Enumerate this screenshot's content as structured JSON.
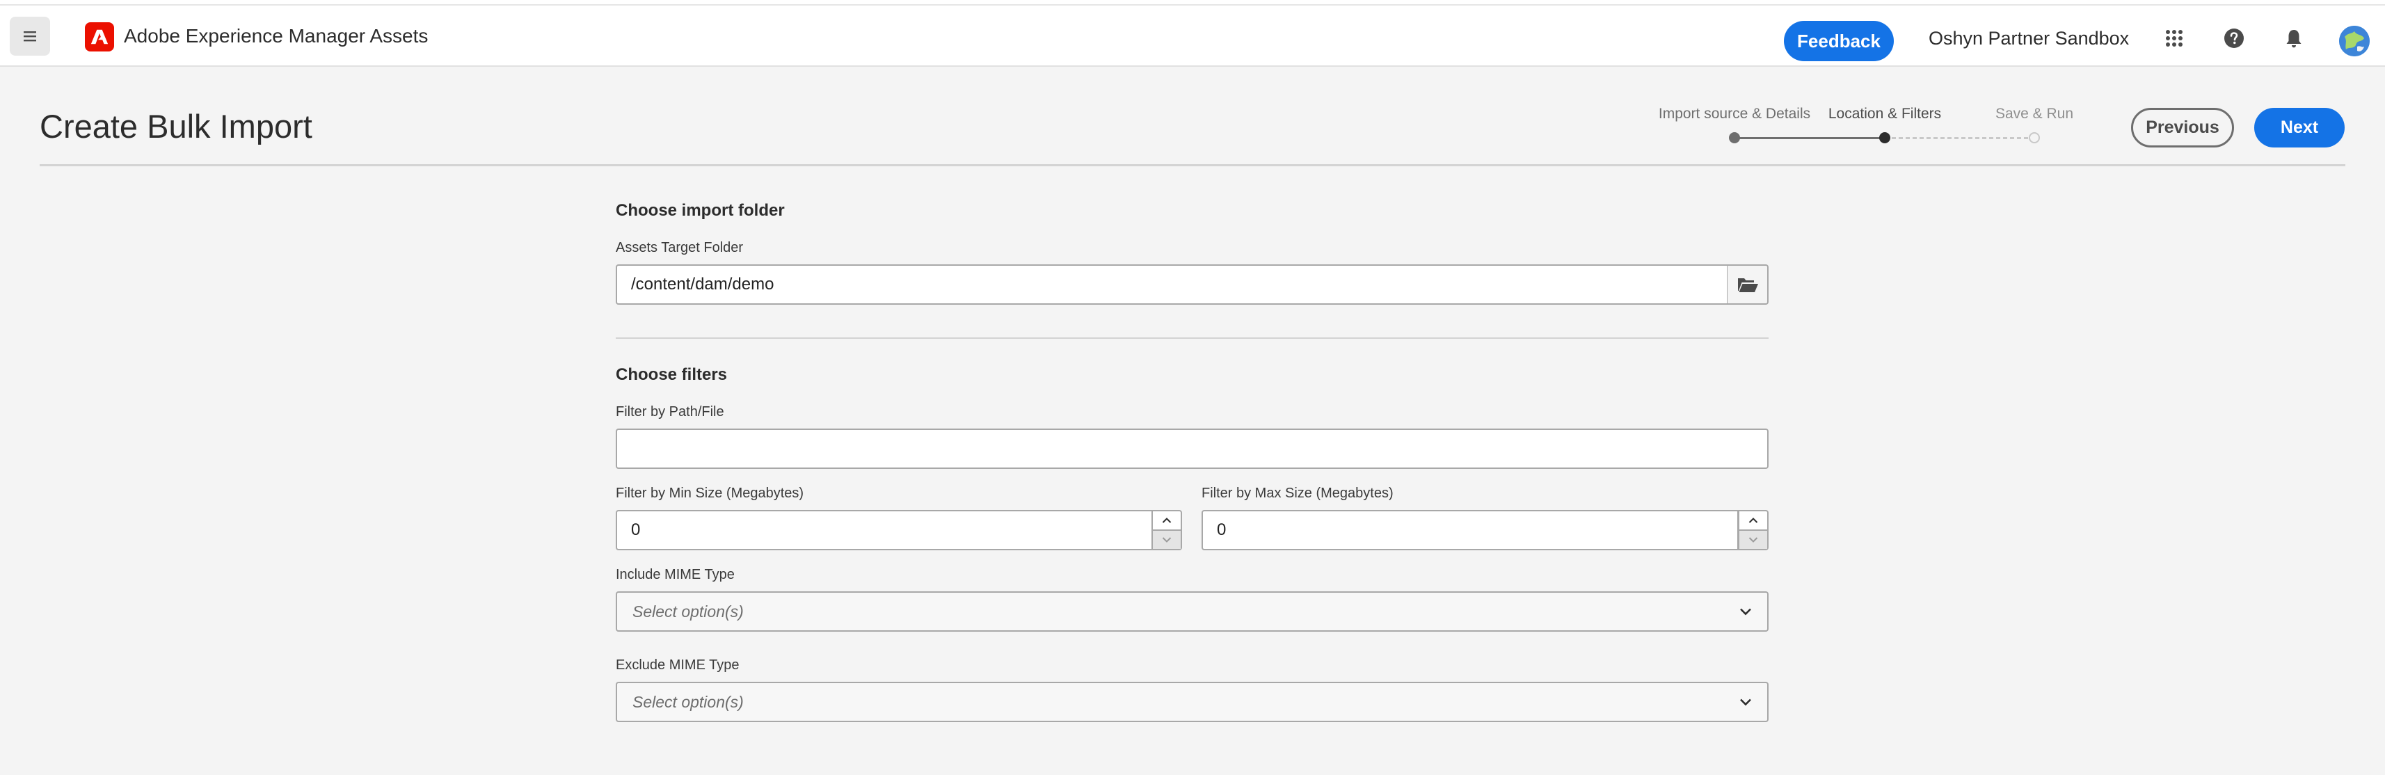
{
  "header": {
    "app_title": "Adobe Experience Manager Assets",
    "feedback_label": "Feedback",
    "org_name": "Oshyn Partner Sandbox",
    "icons": [
      "menu-icon",
      "adobe-logo-icon",
      "apps-grid-icon",
      "help-icon",
      "bell-icon",
      "avatar"
    ]
  },
  "page": {
    "title": "Create Bulk Import",
    "previous_label": "Previous",
    "next_label": "Next"
  },
  "wizard": {
    "steps": [
      {
        "label": "Import source & Details",
        "state": "completed"
      },
      {
        "label": "Location & Filters",
        "state": "current"
      },
      {
        "label": "Save & Run",
        "state": "upcoming"
      }
    ]
  },
  "import_folder": {
    "section_title": "Choose import folder",
    "target_label": "Assets Target Folder",
    "target_value": "/content/dam/demo"
  },
  "filters": {
    "section_title": "Choose filters",
    "path_label": "Filter by Path/File",
    "path_value": "",
    "min_size_label": "Filter by Min Size (Megabytes)",
    "min_size_value": "0",
    "max_size_label": "Filter by Max Size (Megabytes)",
    "max_size_value": "0",
    "include_mime_label": "Include MIME Type",
    "include_mime_placeholder": "Select option(s)",
    "exclude_mime_label": "Exclude MIME Type",
    "exclude_mime_placeholder": "Select option(s)"
  },
  "colors": {
    "accent": "#1473e6",
    "adobe_red": "#eb1000",
    "page_bg": "#f4f4f4"
  }
}
